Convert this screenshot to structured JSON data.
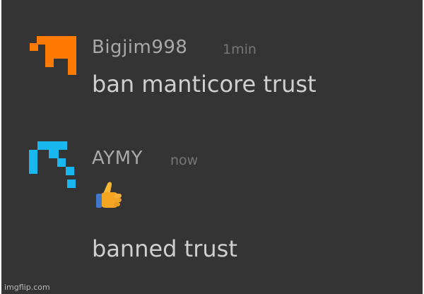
{
  "messages": [
    {
      "username": "Bigjim998",
      "time": "1min",
      "text": "ban manticore trust",
      "avatar_icon": "orange-pixel-face-icon",
      "avatar_color": "#ff7a00"
    },
    {
      "username": "AYMY",
      "time": "now",
      "reaction_icon": "thumbs-up-icon",
      "text": "banned trust",
      "avatar_icon": "cyan-pixel-pickaxe-icon",
      "avatar_color": "#19b7f0"
    }
  ],
  "watermark": "imgflip.com",
  "colors": {
    "background": "#343434",
    "username": "#a9a9a9",
    "timestamp": "#767676",
    "message_text": "#cfcfcf"
  }
}
